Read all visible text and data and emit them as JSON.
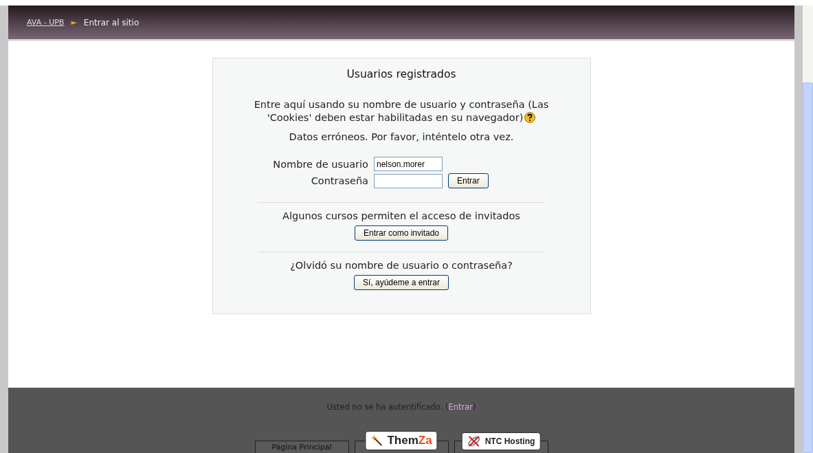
{
  "breadcrumb": {
    "home": "AVA - UPB",
    "separator": "►",
    "current": "Entrar al sitio"
  },
  "login": {
    "title": "Usuarios registrados",
    "intro": "Entre aquí usando su nombre de usuario y contraseña (Las 'Cookies' deben estar habilitadas en su navegador)",
    "error": "Datos erróneos. Por favor, inténtelo otra vez.",
    "fields": [
      {
        "label": "Nombre de usuario",
        "value": "nelson.morer",
        "kind": "text"
      },
      {
        "label": "Contraseña",
        "kind": "password"
      }
    ],
    "submit": "Entrar"
  },
  "guest": {
    "text": "Algunos cursos permiten el acceso de invitados",
    "button": "Entrar como invitado"
  },
  "forgot": {
    "text": "¿Olvidó su nombre de usuario o contraseña?",
    "button": "Sí, ayúdeme a entrar"
  },
  "footer": {
    "status": "Usted no se ha autentificado.",
    "open": "(",
    "link": "Entrar",
    "close": ")",
    "tabs": [
      {
        "kind": "text",
        "label": "Página Principal"
      },
      {
        "kind": "logo",
        "parts": [
          "Them",
          "Za"
        ]
      },
      {
        "kind": "logo",
        "parts": [
          "NTC Hosting"
        ]
      }
    ]
  }
}
